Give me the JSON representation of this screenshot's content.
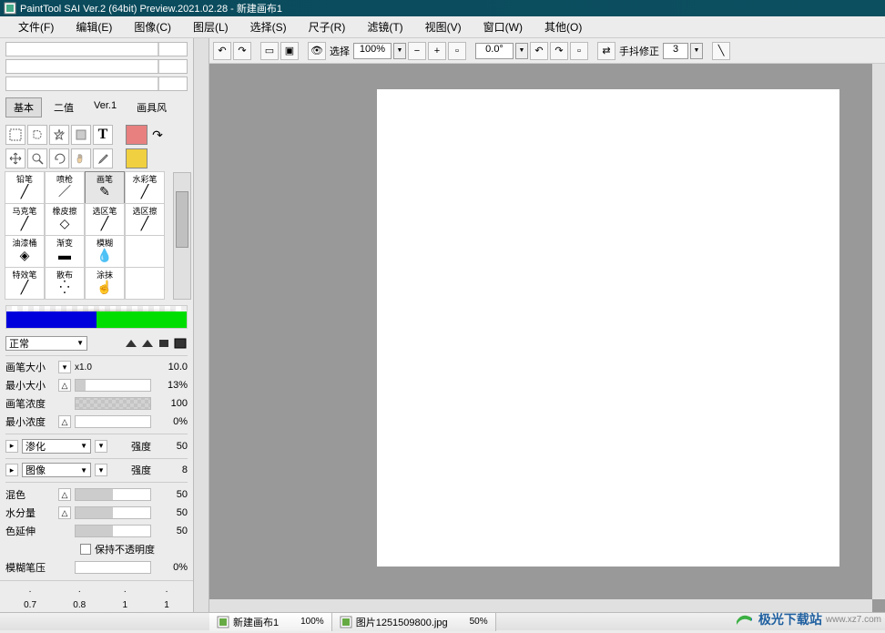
{
  "title": "PaintTool SAI Ver.2 (64bit) Preview.2021.02.28 - 新建画布1",
  "menu": [
    "文件(F)",
    "编辑(E)",
    "图像(C)",
    "图层(L)",
    "选择(S)",
    "尺子(R)",
    "滤镜(T)",
    "视图(V)",
    "窗口(W)",
    "其他(O)"
  ],
  "nav_tabs": {
    "active": "基本",
    "items": [
      "基本",
      "二值",
      "Ver.1",
      "画具风"
    ]
  },
  "tools": [
    [
      "铅笔",
      "喷枪",
      "画笔",
      "水彩笔"
    ],
    [
      "马克笔",
      "橡皮擦",
      "选区笔",
      "选区擦"
    ],
    [
      "油漆桶",
      "渐变",
      "模糊",
      ""
    ],
    [
      "特效笔",
      "散布",
      "涂抹",
      ""
    ]
  ],
  "selected_tool": "画笔",
  "blend_mode": "正常",
  "colors": {
    "fg": "#e88080",
    "bg": "#f0d040"
  },
  "params": {
    "brush_size": {
      "label": "画笔大小",
      "mult": "x1.0",
      "value": "10.0"
    },
    "min_size": {
      "label": "最小大小",
      "value": "13%",
      "fill": 13
    },
    "density": {
      "label": "画笔浓度",
      "value": "100",
      "fill": 100
    },
    "min_density": {
      "label": "最小浓度",
      "value": "0%",
      "fill": 0
    },
    "spread": {
      "label": "渗化",
      "strength_label": "强度",
      "strength": "50"
    },
    "texture": {
      "label": "图像",
      "strength_label": "强度",
      "strength": "8"
    },
    "blend": {
      "label": "混色",
      "value": "50",
      "fill": 50
    },
    "water": {
      "label": "水分量",
      "value": "50",
      "fill": 50
    },
    "extend": {
      "label": "色延伸",
      "value": "50",
      "fill": 50
    },
    "keep_opacity": "保持不透明度",
    "blur_pressure": {
      "label": "模糊笔压",
      "value": "0%",
      "fill": 0
    }
  },
  "size_presets": [
    "0.7",
    "0.8",
    "1",
    "1"
  ],
  "toolbar": {
    "select_label": "选择",
    "zoom": "100%",
    "angle": "0.0°",
    "stabilizer_label": "手抖修正",
    "stabilizer_value": "3"
  },
  "tabs": [
    {
      "name": "新建画布1",
      "pct": "100%",
      "active": true
    },
    {
      "name": "图片1251509800.jpg",
      "pct": "50%",
      "active": false
    }
  ],
  "watermark": {
    "cn": "极光下载站",
    "url": "www.xz7.com"
  }
}
